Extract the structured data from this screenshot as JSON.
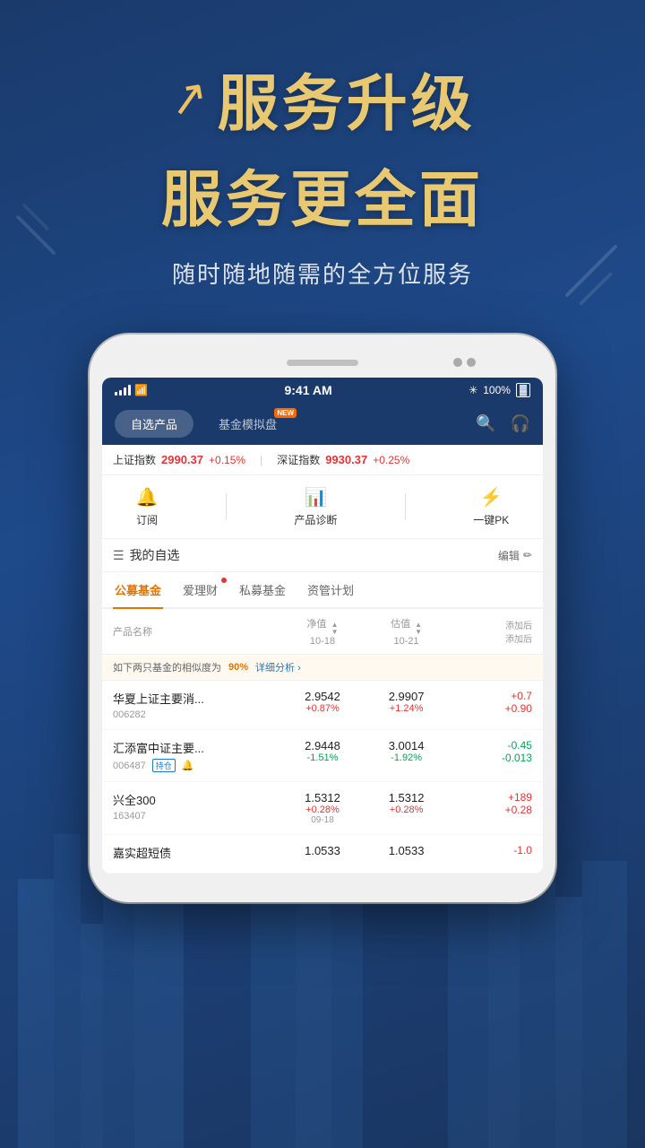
{
  "hero": {
    "arrow_symbol": "↗",
    "title_line1": "服务升级",
    "title_line2": "服务更全面",
    "description": "随时随地随需的全方位服务"
  },
  "phone": {
    "status_bar": {
      "time": "9:41 AM",
      "battery": "100%",
      "signal": "..ll"
    },
    "nav_tabs": [
      {
        "label": "自选产品",
        "active": true,
        "new_badge": false
      },
      {
        "label": "基金模拟盘",
        "active": false,
        "new_badge": true
      }
    ],
    "ticker": {
      "sh_label": "上证指数",
      "sh_value": "2990.37",
      "sh_change": "+0.15%",
      "sz_label": "深证指数",
      "sz_value": "9930.37",
      "sz_change": "+0.25%"
    },
    "actions": [
      {
        "icon": "🔔",
        "label": "订阅"
      },
      {
        "icon": "📊",
        "label": "产品诊断"
      },
      {
        "icon": "⚡",
        "label": "一键PK"
      }
    ],
    "section": {
      "title": "我的自选",
      "icon": "☰",
      "edit_label": "编辑"
    },
    "cat_tabs": [
      {
        "label": "公募基金",
        "active": true,
        "dot": false
      },
      {
        "label": "爱理财",
        "active": false,
        "dot": true
      },
      {
        "label": "私募基金",
        "active": false,
        "dot": false
      },
      {
        "label": "资管计划",
        "active": false,
        "dot": false
      }
    ],
    "table_header": {
      "col_name": "产品名称",
      "col_nav": "净值",
      "col_nav_date": "10-18",
      "col_est": "估值",
      "col_est_date": "10-21",
      "col_add": "添加后",
      "col_add2": "添加后"
    },
    "alert": {
      "text": "如下两只基金的相似度为",
      "highlight": "90%",
      "link": "详细分析 ›"
    },
    "funds": [
      {
        "name": "华夏上证主要消...",
        "code": "006282",
        "badge": null,
        "bell": false,
        "nav_val": "2.9542",
        "nav_change": "+0.87%",
        "nav_change_type": "red",
        "est_val": "2.9907",
        "est_change": "+1.24%",
        "est_change_type": "red",
        "add_val": "+0.7",
        "add_val2": "+0.90",
        "add_type": "red"
      },
      {
        "name": "汇添富中证主要...",
        "code": "006487",
        "badge": "持仓",
        "bell": true,
        "nav_val": "2.9448",
        "nav_change": "-1.51%",
        "nav_change_type": "green",
        "est_val": "3.0014",
        "est_change": "-1.92%",
        "est_change_type": "green",
        "add_val": "-0.45",
        "add_val2": "-0.013",
        "add_type": "green"
      },
      {
        "name": "兴全300",
        "code": "163407",
        "badge": null,
        "bell": false,
        "nav_val": "1.5312",
        "nav_change": "+0.28%",
        "nav_change_type": "red",
        "est_val": "1.5312",
        "est_change": "+0.28%",
        "est_change_type": "red",
        "add_val": "+189",
        "add_val2": "+0.28",
        "nav_date": "09-18",
        "add_type": "red"
      },
      {
        "name": "嘉实超短债",
        "code": "",
        "badge": null,
        "bell": false,
        "nav_val": "1.0533",
        "nav_change": "",
        "nav_change_type": "red",
        "est_val": "1.0533",
        "est_change": "",
        "est_change_type": "red",
        "add_val": "-1.0",
        "add_val2": "",
        "add_type": "red"
      }
    ]
  }
}
